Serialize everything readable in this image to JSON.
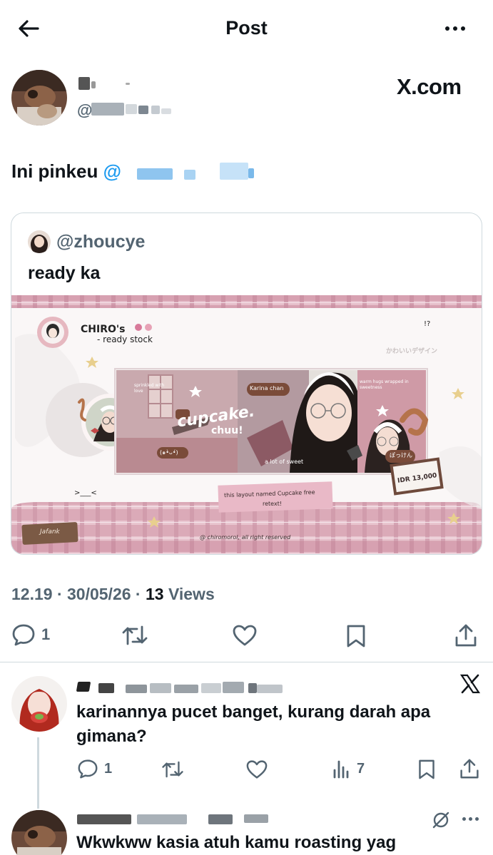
{
  "header": {
    "title": "Post"
  },
  "post": {
    "source_label": "X.com",
    "text": "Ini pinkeu",
    "mention_prefix": "@",
    "timestamp": "12.19 · 30/05/26 · ",
    "views_count": "13",
    "views_label": " Views"
  },
  "quote": {
    "handle": "@zhoucye",
    "text": "ready ka",
    "image": {
      "brand": "CHIRO's",
      "brand_sub": "- ready stock",
      "badge": "!?",
      "jp_text": "かわいいデザイン",
      "title": "cupcake.",
      "subtitle": "chuu!",
      "name_tag": "Karina chan",
      "caption": "a lot of sweet",
      "warm_hugs": "warm hugs wrapped in sweetness",
      "sprinkled": "sprinkled with love",
      "kaomoji1": "(๑•̀ᴗ•́)",
      "kaomoji2": ">___<",
      "jp_tag": "ぽっけん",
      "price": "IDR 13,000",
      "note": "this layout named Cupcake free",
      "note2": "retext!",
      "footer": "@ chiromorol, all right reserved",
      "label_tag": "Jafank"
    }
  },
  "actions": {
    "reply_count": "1"
  },
  "reply1": {
    "text": "karinannya pucet banget, kurang darah apa gimana?",
    "reply_count": "1",
    "views_count": "7"
  },
  "reply2": {
    "text": "Wkwkww kasia atuh kamu roasting yag"
  },
  "colors": {
    "accent": "#1d9bf0",
    "muted": "#536471",
    "text": "#0f1419",
    "border": "#cfd9de",
    "pink": "#d9a4b2"
  },
  "icons": [
    "back-arrow-icon",
    "more-icon",
    "reply-icon",
    "retweet-icon",
    "like-icon",
    "bookmark-icon",
    "share-icon",
    "views-icon",
    "x-logo-icon",
    "grok-icon"
  ]
}
